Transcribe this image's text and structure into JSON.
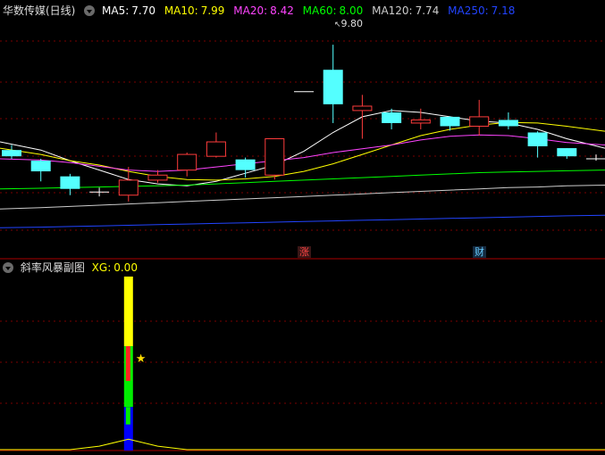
{
  "main_panel": {
    "title": "华数传媒(日线)",
    "indicators": [
      {
        "label": "MA5:",
        "value": "7.70",
        "color": "#ffffff"
      },
      {
        "label": "MA10:",
        "value": "7.99",
        "color": "#ffff00"
      },
      {
        "label": "MA20:",
        "value": "8.42",
        "color": "#ff44ff"
      },
      {
        "label": "MA60:",
        "value": "8.00",
        "color": "#00ff00"
      },
      {
        "label": "MA120:",
        "value": "7.74",
        "color": "#cccccc"
      },
      {
        "label": "MA250:",
        "value": "7.18",
        "color": "#2244ff"
      }
    ],
    "high_annotation": "9.80",
    "event_tags": [
      {
        "text": "涨",
        "color": "#ff4444"
      },
      {
        "text": "财",
        "color": "#66ccff"
      }
    ]
  },
  "sub_panel": {
    "title": "斜率风暴副图",
    "xg_label": "XG:",
    "xg_value": "0.00",
    "xg_color": "#ffff00"
  },
  "chart_data": {
    "type": "candlestick",
    "ylim": [
      6.5,
      10.2
    ],
    "candles": [
      {
        "o": 8.12,
        "c": 8.02,
        "h": 8.2,
        "l": 7.98
      },
      {
        "o": 7.95,
        "c": 7.78,
        "h": 7.98,
        "l": 7.62
      },
      {
        "o": 7.7,
        "c": 7.5,
        "h": 7.74,
        "l": 7.4
      },
      {
        "o": 7.45,
        "c": 7.45,
        "h": 7.52,
        "l": 7.38
      },
      {
        "o": 7.4,
        "c": 7.64,
        "h": 7.85,
        "l": 7.3
      },
      {
        "o": 7.64,
        "c": 7.72,
        "h": 7.8,
        "l": 7.6
      },
      {
        "o": 7.8,
        "c": 8.05,
        "h": 8.08,
        "l": 7.7
      },
      {
        "o": 8.02,
        "c": 8.25,
        "h": 8.4,
        "l": 8.0
      },
      {
        "o": 7.97,
        "c": 7.8,
        "h": 8.0,
        "l": 7.68
      },
      {
        "o": 7.72,
        "c": 8.3,
        "h": 8.3,
        "l": 7.65
      },
      {
        "o": 9.05,
        "c": 9.05,
        "h": 9.05,
        "l": 9.05
      },
      {
        "o": 9.4,
        "c": 8.85,
        "h": 9.8,
        "l": 8.55
      },
      {
        "o": 8.75,
        "c": 8.82,
        "h": 9.0,
        "l": 8.3
      },
      {
        "o": 8.72,
        "c": 8.55,
        "h": 8.78,
        "l": 8.45
      },
      {
        "o": 8.55,
        "c": 8.6,
        "h": 8.78,
        "l": 8.45
      },
      {
        "o": 8.65,
        "c": 8.5,
        "h": 8.66,
        "l": 8.43
      },
      {
        "o": 8.5,
        "c": 8.65,
        "h": 8.92,
        "l": 8.35
      },
      {
        "o": 8.6,
        "c": 8.5,
        "h": 8.72,
        "l": 8.45
      },
      {
        "o": 8.4,
        "c": 8.18,
        "h": 8.42,
        "l": 8.0
      },
      {
        "o": 8.15,
        "c": 8.02,
        "h": 8.15,
        "l": 7.98
      },
      {
        "o": 7.98,
        "c": 7.98,
        "h": 8.05,
        "l": 7.95
      }
    ],
    "ma_lines": [
      {
        "name": "MA5",
        "color": "#ffffff",
        "values": [
          8.25,
          8.12,
          7.95,
          7.8,
          7.65,
          7.58,
          7.55,
          7.62,
          7.75,
          7.88,
          8.1,
          8.4,
          8.65,
          8.75,
          8.72,
          8.65,
          8.58,
          8.55,
          8.45,
          8.3,
          8.15
        ]
      },
      {
        "name": "MA10",
        "color": "#ffff00",
        "values": [
          8.15,
          8.05,
          7.95,
          7.88,
          7.78,
          7.7,
          7.65,
          7.64,
          7.66,
          7.7,
          7.78,
          7.9,
          8.05,
          8.2,
          8.35,
          8.45,
          8.52,
          8.56,
          8.55,
          8.5,
          8.42
        ]
      },
      {
        "name": "MA20",
        "color": "#ff44ff",
        "values": [
          7.98,
          7.96,
          7.92,
          7.86,
          7.8,
          7.78,
          7.8,
          7.85,
          7.9,
          7.95,
          8.0,
          8.08,
          8.14,
          8.2,
          8.28,
          8.34,
          8.36,
          8.35,
          8.3,
          8.24,
          8.2
        ]
      },
      {
        "name": "MA60",
        "color": "#00ff00",
        "values": [
          7.5,
          7.51,
          7.52,
          7.53,
          7.54,
          7.55,
          7.56,
          7.58,
          7.6,
          7.62,
          7.64,
          7.66,
          7.68,
          7.7,
          7.72,
          7.74,
          7.76,
          7.77,
          7.78,
          7.79,
          7.8
        ]
      },
      {
        "name": "MA120",
        "color": "#cccccc",
        "values": [
          7.18,
          7.2,
          7.22,
          7.24,
          7.26,
          7.28,
          7.3,
          7.32,
          7.34,
          7.36,
          7.38,
          7.4,
          7.42,
          7.44,
          7.46,
          7.48,
          7.5,
          7.52,
          7.53,
          7.55,
          7.56
        ]
      },
      {
        "name": "MA250",
        "color": "#2244ff",
        "values": [
          6.88,
          6.89,
          6.9,
          6.91,
          6.92,
          6.93,
          6.94,
          6.95,
          6.96,
          6.97,
          6.98,
          6.99,
          7.0,
          7.01,
          7.02,
          7.03,
          7.04,
          7.05,
          7.06,
          7.07,
          7.08
        ]
      }
    ],
    "sub_chart": {
      "ylim": [
        0,
        100
      ],
      "bar_index": 4,
      "segments": [
        {
          "from": 60,
          "to": 100,
          "color": "#ffff00"
        },
        {
          "from": 25,
          "to": 60,
          "color": "#00ee00"
        },
        {
          "from": 0,
          "to": 25,
          "color": "#0000ff"
        }
      ],
      "xg_line": [
        0,
        0,
        0,
        2,
        6,
        2,
        0,
        0,
        0,
        0,
        0,
        0,
        0,
        0,
        0,
        0,
        0,
        0,
        0,
        0,
        0
      ],
      "signal_index": 4
    }
  }
}
